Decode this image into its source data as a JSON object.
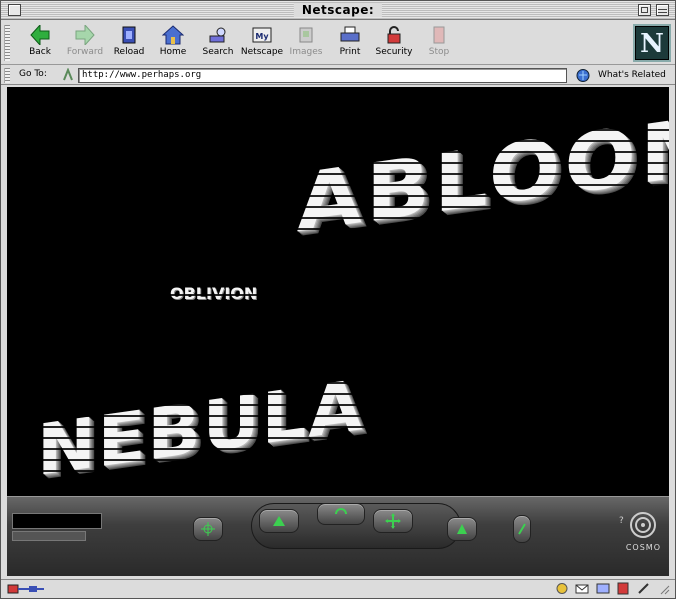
{
  "window": {
    "title": "Netscape:"
  },
  "toolbar": {
    "buttons": [
      {
        "label": "Back",
        "icon": "back-arrow-icon",
        "enabled": true
      },
      {
        "label": "Forward",
        "icon": "forward-arrow-icon",
        "enabled": false
      },
      {
        "label": "Reload",
        "icon": "reload-icon",
        "enabled": true
      },
      {
        "label": "Home",
        "icon": "home-icon",
        "enabled": true
      },
      {
        "label": "Search",
        "icon": "search-icon",
        "enabled": true
      },
      {
        "label": "Netscape",
        "icon": "my-netscape-icon",
        "enabled": true
      },
      {
        "label": "Images",
        "icon": "images-icon",
        "enabled": false
      },
      {
        "label": "Print",
        "icon": "printer-icon",
        "enabled": true
      },
      {
        "label": "Security",
        "icon": "security-lock-icon",
        "enabled": true
      },
      {
        "label": "Stop",
        "icon": "stop-icon",
        "enabled": false
      }
    ],
    "logo_letter": "N"
  },
  "location": {
    "label": "Go To:",
    "url": "http://www.perhaps.org",
    "related_label": "What's Related"
  },
  "content": {
    "words": [
      "ABLOOM",
      "OBLIVION",
      "NEBULA"
    ],
    "background": "#000000"
  },
  "console": {
    "brand": "COSMO"
  },
  "colors": {
    "chrome": "#dcdcdc",
    "console_green": "#3cd050"
  }
}
